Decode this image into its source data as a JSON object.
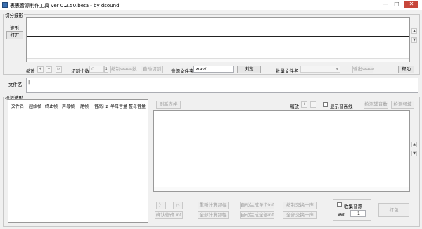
{
  "window": {
    "title": "表表音源制作工具 ver 0.2.50.beta - by dsound",
    "minimize": "—",
    "maximize": "□",
    "close": "✕"
  },
  "split_section": {
    "group_label": "切分波形",
    "wave_label": "波形",
    "open_button": "打开",
    "scroll_up": "▲",
    "scroll_down": "▼",
    "zoom_label": "缩放",
    "zoom_plus": "+",
    "zoom_minus": "−",
    "zoom_right": "▷",
    "cut_count_label": "切割个数",
    "cut_count_value": "0",
    "cut_count_spin": "↕",
    "copy_wave_button": "缩制wave数",
    "auto_cut_button": "自动切割",
    "audio_folder_label": "音源文件夹",
    "audio_folder_value": "wav/",
    "browse_button": "浏览",
    "batch_filename_label": "批量文件名",
    "batch_filename_value": "",
    "dropdown_arrow": "▾",
    "output_wave_button": "输出wave",
    "help_button": "帮助",
    "filename_label": "文件名",
    "filename_value": "|"
  },
  "mark_section": {
    "group_label": "标记波形",
    "table_headers": [
      "文件名",
      "起始帧",
      "终止帧",
      "声母帧",
      "尾帧",
      "音高Hz",
      "半母音量",
      "整母音量"
    ],
    "refresh_button": "刷新表格",
    "zoom_label": "缩放",
    "zoom_plus": "+",
    "zoom_minus": "−",
    "show_waveline_label": "显示音高线",
    "detect_pitch_button": "检测辅音数",
    "detect_end_button": "检测频域",
    "scroll_up": "▲",
    "scroll_down": "▼"
  },
  "bottom_controls": {
    "prev_button": "〉",
    "next_button": "▷",
    "confirm_modify_button": "确认修改.inf",
    "recalc_button": "重新计算频幅",
    "calc_all_button": "全部计算频幅",
    "auto_gen_single_button": "自动生成单个inf",
    "auto_gen_all_button": "自动生成全部inf",
    "copy_one_button": "缩制交换一声",
    "copy_all_button": "全部交换一声",
    "collect_audio_label": "收集音源",
    "ver_label": "ver",
    "ver_value": "1",
    "pack_button": "打包"
  }
}
